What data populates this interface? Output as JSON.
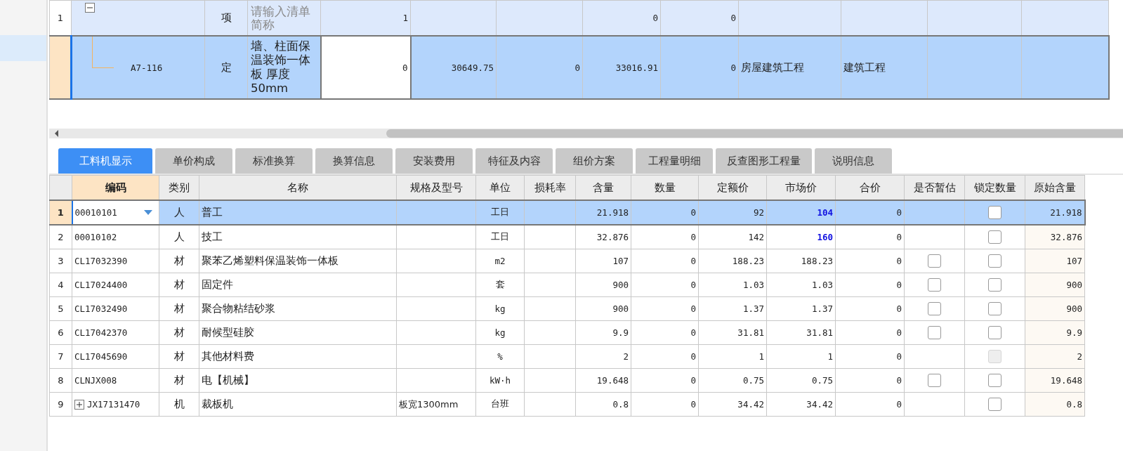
{
  "sidebar": {
    "items": [
      {
        "selected": true
      }
    ]
  },
  "top_table": {
    "rows": [
      {
        "number": "1",
        "expanded": true,
        "type": "项",
        "name_placeholder": "请输入清单简称",
        "selected": false,
        "cells": {
          "column_5": "1",
          "column_8": "0",
          "column_9": "0"
        },
        "children": [
          {
            "code": "A7-116",
            "type": "定",
            "name": "墙、柱面保温装饰一体板 厚度50mm",
            "selected": true,
            "cells": {
              "column_5": "0",
              "column_6": "30649.75",
              "column_7": "0",
              "column_8": "33016.91",
              "column_9": "0",
              "column_10": "房屋建筑工程",
              "column_11": "建筑工程"
            }
          }
        ]
      }
    ]
  },
  "tabs": [
    {
      "label": "工料机显示",
      "selected": true
    },
    {
      "label": "单价构成",
      "selected": false
    },
    {
      "label": "标准换算",
      "selected": false
    },
    {
      "label": "换算信息",
      "selected": false
    },
    {
      "label": "安装费用",
      "selected": false
    },
    {
      "label": "特征及内容",
      "selected": false
    },
    {
      "label": "组价方案",
      "selected": false
    },
    {
      "label": "工程量明细",
      "selected": false
    },
    {
      "label": "反查图形工程量",
      "selected": false
    },
    {
      "label": "说明信息",
      "selected": false
    }
  ],
  "table": {
    "columns": [
      {
        "label": "编码",
        "selected": true
      },
      {
        "label": "类别",
        "selected": false
      },
      {
        "label": "名称",
        "selected": false
      },
      {
        "label": "规格及型号",
        "selected": false
      },
      {
        "label": "单位",
        "selected": false
      },
      {
        "label": "损耗率",
        "selected": false
      },
      {
        "label": "含量",
        "selected": false
      },
      {
        "label": "数量",
        "selected": false
      },
      {
        "label": "定额价",
        "selected": false
      },
      {
        "label": "市场价",
        "selected": false
      },
      {
        "label": "合价",
        "selected": false
      },
      {
        "label": "是否暂估",
        "selected": false
      },
      {
        "label": "锁定数量",
        "selected": false
      },
      {
        "label": "原始含量",
        "selected": false
      }
    ],
    "rows": [
      {
        "number": "1",
        "code": "00010101",
        "type": "人",
        "name": "普工",
        "unit": "工日",
        "content": "21.918",
        "quantity": "0",
        "quota_price": "92",
        "market_price": "104",
        "price_changed": true,
        "total": "0",
        "lock_checked": false,
        "lock_disabled": false,
        "original": "21.918",
        "selected": true
      },
      {
        "number": "2",
        "code": "00010102",
        "type": "人",
        "name": "技工",
        "unit": "工日",
        "content": "32.876",
        "quantity": "0",
        "quota_price": "142",
        "market_price": "160",
        "price_changed": true,
        "total": "0",
        "lock_checked": false,
        "lock_disabled": false,
        "original": "32.876",
        "selected": false
      },
      {
        "number": "3",
        "code": "CL17032390",
        "type": "材",
        "name": "聚苯乙烯塑料保温装饰一体板",
        "unit": "m2",
        "content": "107",
        "quantity": "0",
        "quota_price": "188.23",
        "market_price": "188.23",
        "price_changed": false,
        "total": "0",
        "estimate_checked": false,
        "lock_checked": false,
        "lock_disabled": false,
        "original": "107",
        "selected": false
      },
      {
        "number": "4",
        "code": "CL17024400",
        "type": "材",
        "name": "固定件",
        "unit": "套",
        "content": "900",
        "quantity": "0",
        "quota_price": "1.03",
        "market_price": "1.03",
        "price_changed": false,
        "total": "0",
        "estimate_checked": false,
        "lock_checked": false,
        "lock_disabled": false,
        "original": "900",
        "selected": false
      },
      {
        "number": "5",
        "code": "CL17032490",
        "type": "材",
        "name": "聚合物粘结砂浆",
        "unit": "kg",
        "content": "900",
        "quantity": "0",
        "quota_price": "1.37",
        "market_price": "1.37",
        "price_changed": false,
        "total": "0",
        "estimate_checked": false,
        "lock_checked": false,
        "lock_disabled": false,
        "original": "900",
        "selected": false
      },
      {
        "number": "6",
        "code": "CL17042370",
        "type": "材",
        "name": "耐候型硅胶",
        "unit": "kg",
        "content": "9.9",
        "quantity": "0",
        "quota_price": "31.81",
        "market_price": "31.81",
        "price_changed": false,
        "total": "0",
        "estimate_checked": false,
        "lock_checked": false,
        "lock_disabled": false,
        "original": "9.9",
        "selected": false
      },
      {
        "number": "7",
        "code": "CL17045690",
        "type": "材",
        "name": "其他材料费",
        "unit": "%",
        "content": "2",
        "quantity": "0",
        "quota_price": "1",
        "market_price": "1",
        "price_changed": false,
        "total": "0",
        "lock_checked": false,
        "lock_disabled": true,
        "original": "2",
        "selected": false
      },
      {
        "number": "8",
        "code": "CLNJX008",
        "type": "材",
        "name": "电【机械】",
        "unit": "kW·h",
        "content": "19.648",
        "quantity": "0",
        "quota_price": "0.75",
        "market_price": "0.75",
        "price_changed": false,
        "total": "0",
        "estimate_checked": false,
        "lock_checked": false,
        "lock_disabled": false,
        "original": "19.648",
        "selected": false
      },
      {
        "number": "9",
        "code": "JX17131470",
        "expanded": false,
        "type": "机",
        "name": "裁板机",
        "spec": "板宽1300mm",
        "unit": "台班",
        "content": "0.8",
        "quantity": "0",
        "quota_price": "34.42",
        "market_price": "34.42",
        "price_changed": false,
        "total": "0",
        "lock_checked": false,
        "lock_disabled": false,
        "original": "0.8",
        "selected": false
      }
    ]
  }
}
